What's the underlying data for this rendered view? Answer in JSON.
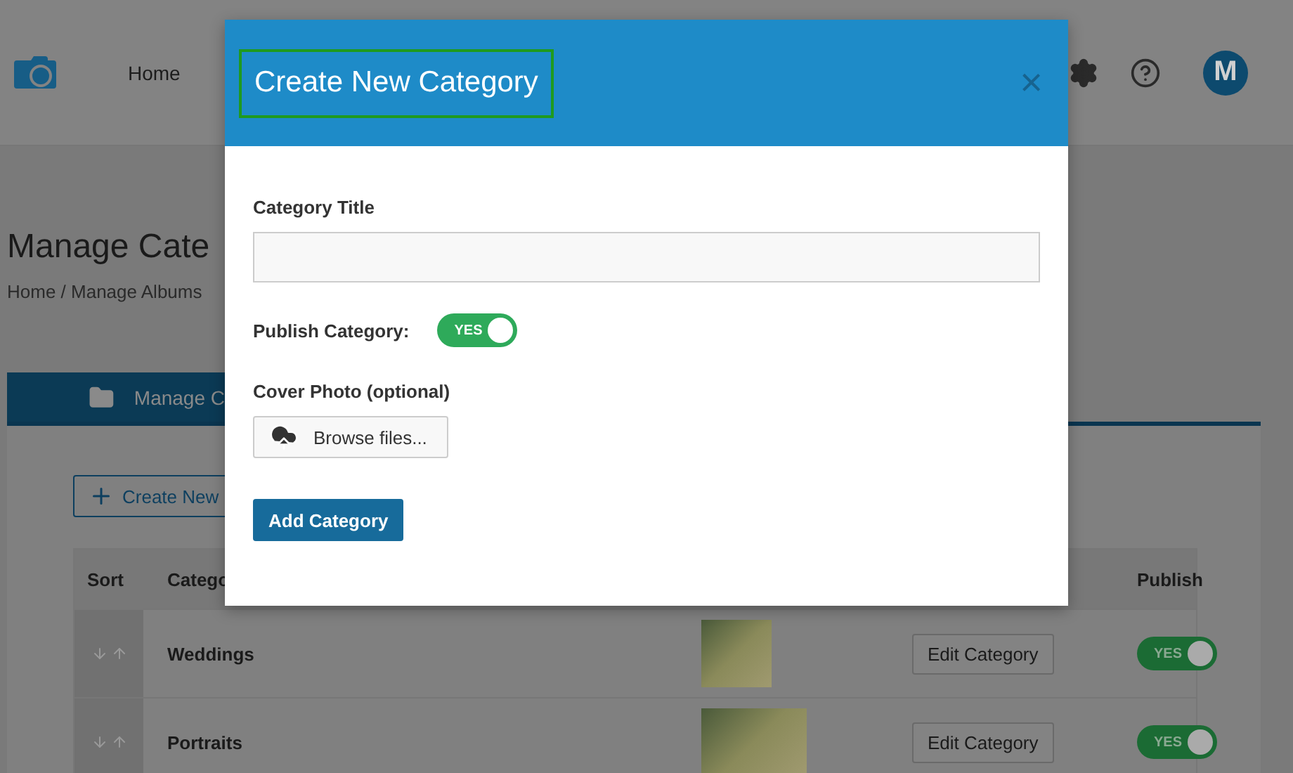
{
  "nav": {
    "items": [
      {
        "label": "Home",
        "selected": false
      }
    ],
    "avatar": "M"
  },
  "page": {
    "title": "Manage Cate",
    "breadcrumb": "Home / Manage Albums"
  },
  "tabs": [
    {
      "label": "Manage C",
      "selected": true
    }
  ],
  "create_button": "Create New",
  "table": {
    "columns": [
      "Sort",
      "Catego",
      "Publish"
    ],
    "rows": [
      {
        "title": "Weddings",
        "edit": "Edit Category",
        "published": true,
        "toggle": "YES"
      },
      {
        "title": "Portraits",
        "edit": "Edit Category",
        "published": true,
        "toggle": "YES"
      }
    ]
  },
  "modal": {
    "title": "Create New Category",
    "close": "×",
    "fields": [
      {
        "kind": "text",
        "label": "Category Title"
      },
      {
        "kind": "toggle",
        "label": "Publish Category:",
        "on": true,
        "text": "YES"
      },
      {
        "kind": "file",
        "label": "Cover Photo (optional)",
        "button": "Browse files..."
      }
    ],
    "submit": "Add Category"
  }
}
